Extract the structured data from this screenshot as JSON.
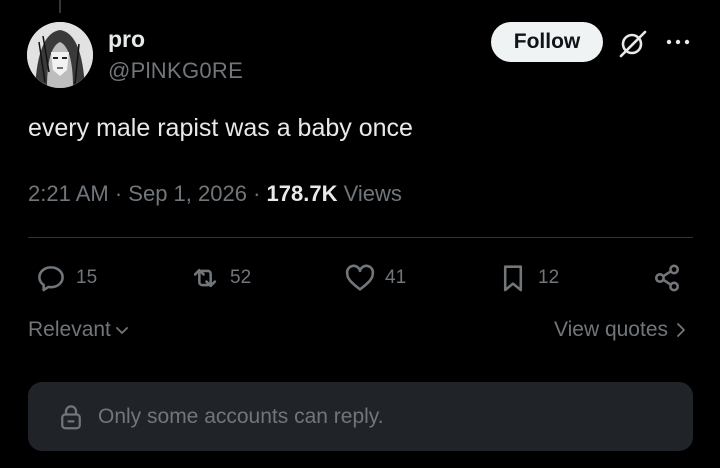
{
  "author": {
    "name": "pro",
    "handle": "@PlNKG0RE"
  },
  "header": {
    "follow_label": "Follow",
    "grok_icon": "grok-slash-circle-icon",
    "more_icon": "more-dots-icon"
  },
  "post": {
    "text": "every male rapist was a baby once",
    "time": "2:21 AM",
    "date": "Sep 1, 2026",
    "views_count": "178.7K",
    "views_label": "Views",
    "separator": "·"
  },
  "actions": {
    "replies": "15",
    "reposts": "52",
    "likes": "41",
    "bookmarks": "12"
  },
  "replies_section": {
    "sort_label": "Relevant",
    "view_quotes_label": "View quotes",
    "restriction_note": "Only some accounts can reply."
  },
  "colors": {
    "background": "#000000",
    "text_primary": "#e7e9ea",
    "text_secondary": "#71767b",
    "follow_bg": "#eff3f4",
    "reply_box_bg": "#202327",
    "divider": "#2f3336"
  }
}
